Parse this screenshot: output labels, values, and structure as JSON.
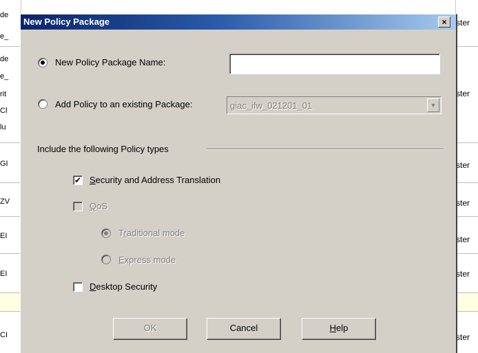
{
  "background": {
    "left_fragments": [
      "de",
      "e_",
      "de",
      "e_",
      "rit",
      "Cl",
      "lu",
      "GI",
      "ZV",
      "EI",
      "EI",
      "CI"
    ],
    "right_fragments": [
      "ster",
      "ster",
      "ster",
      "ster",
      "ster",
      "ster",
      "ster"
    ]
  },
  "dialog": {
    "title": "New Policy Package",
    "close_symbol": "×",
    "new_package_label": "New Policy Package Name:",
    "new_package_value": "",
    "add_existing_label": "Add Policy to an existing Package:",
    "existing_package_value": "giac_ifw_021201_01",
    "combo_arrow": "▼",
    "group_label": "Include the following Policy types",
    "security_first": "S",
    "security_rest": "ecurity and Address Translation",
    "security_check": "✔",
    "qos_first": "Q",
    "qos_rest": "oS",
    "traditional_pre": "T",
    "traditional_u": "r",
    "traditional_rest": "aditional mode",
    "express_first": "E",
    "express_rest": "xpress mode",
    "desktop_first": "D",
    "desktop_rest": "esktop Security",
    "ok_label": "OK",
    "cancel_label": "Cancel",
    "help_first": "H",
    "help_rest": "elp"
  },
  "colors": {
    "title_bar": "#0a246a",
    "dialog_face": "#d4d0c8",
    "highlight_row": "#ffffe1"
  }
}
